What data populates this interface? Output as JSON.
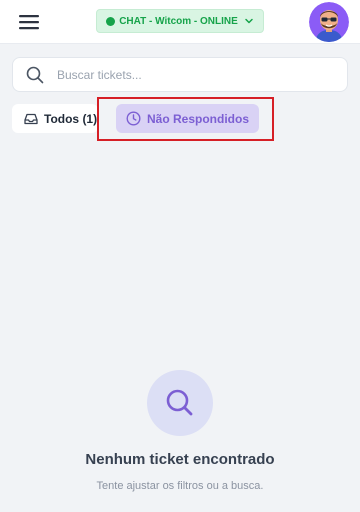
{
  "header": {
    "status_label": "CHAT - Witcom - ONLINE",
    "status_color": "#16a34a",
    "status_bg": "#d9f5e3",
    "menu_icon": "hamburger-menu-icon",
    "avatar_icon": "user-avatar-memoji"
  },
  "search": {
    "value": "",
    "placeholder": "Buscar tickets...",
    "icon": "search-icon"
  },
  "tabs": [
    {
      "label": "Todos (1)",
      "icon": "inbox-icon",
      "selected": false
    },
    {
      "label": "Não Respondidos",
      "icon": "clock-icon",
      "selected": true,
      "accent": "#7c5fd3"
    }
  ],
  "empty_state": {
    "icon": "search-icon",
    "title": "Nenhum ticket encontrado",
    "subtitle": "Tente ajustar os filtros ou a busca."
  },
  "highlight_color": "#d61f26"
}
